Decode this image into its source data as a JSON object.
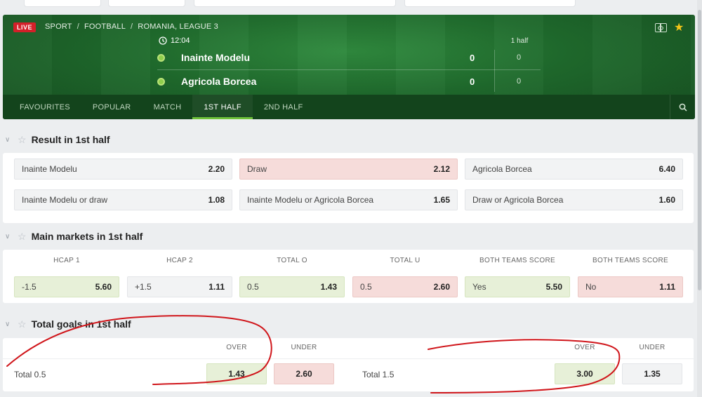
{
  "header": {
    "live_label": "LIVE",
    "breadcrumb": [
      "SPORT",
      "FOOTBALL",
      "ROMANIA, LEAGUE 3"
    ],
    "time": "12:04",
    "period_label": "1 half",
    "teams": [
      {
        "name": "Inainte Modelu",
        "score": "0",
        "half_score": "0"
      },
      {
        "name": "Agricola Borcea",
        "score": "0",
        "half_score": "0"
      }
    ],
    "accent_color": "#6fc23a",
    "live_color": "#d32029"
  },
  "tabs": [
    {
      "label": "FAVOURITES",
      "active": false
    },
    {
      "label": "POPULAR",
      "active": false
    },
    {
      "label": "MATCH",
      "active": false
    },
    {
      "label": "1ST HALF",
      "active": true
    },
    {
      "label": "2ND HALF",
      "active": false
    }
  ],
  "result_section": {
    "title": "Result in 1st half",
    "odds": [
      {
        "label": "Inainte Modelu",
        "value": "2.20"
      },
      {
        "label": "Draw",
        "value": "2.12"
      },
      {
        "label": "Agricola Borcea",
        "value": "6.40"
      },
      {
        "label": "Inainte Modelu or draw",
        "value": "1.08"
      },
      {
        "label": "Inainte Modelu or Agricola Borcea",
        "value": "1.65"
      },
      {
        "label": "Draw or Agricola Borcea",
        "value": "1.60"
      }
    ]
  },
  "main_markets": {
    "title": "Main markets in 1st half",
    "columns": [
      "HCAP 1",
      "HCAP 2",
      "TOTAL O",
      "TOTAL U",
      "BOTH TEAMS SCORE",
      "BOTH TEAMS SCORE"
    ],
    "odds": [
      {
        "label": "-1.5",
        "value": "5.60"
      },
      {
        "label": "+1.5",
        "value": "1.11"
      },
      {
        "label": "0.5",
        "value": "1.43"
      },
      {
        "label": "0.5",
        "value": "2.60"
      },
      {
        "label": "Yes",
        "value": "5.50"
      },
      {
        "label": "No",
        "value": "1.11"
      }
    ]
  },
  "total_goals": {
    "title": "Total goals in 1st half",
    "over_label": "OVER",
    "under_label": "UNDER",
    "rows": [
      {
        "label": "Total 0.5",
        "over": "1.43",
        "under": "2.60"
      },
      {
        "label": "Total 1.5",
        "over": "3.00",
        "under": "1.35"
      }
    ]
  },
  "icons": [
    "clock-icon",
    "pitch-icon",
    "star-icon",
    "search-icon",
    "chevron-down-icon",
    "star-outline-icon"
  ],
  "annotation_color": "#d0161b"
}
